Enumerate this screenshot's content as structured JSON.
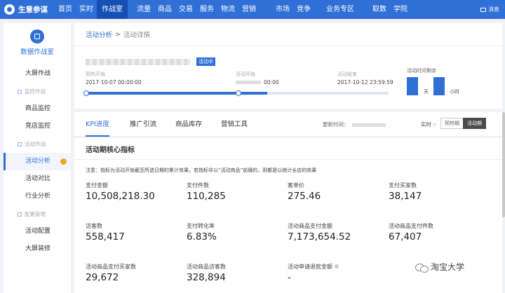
{
  "nav": {
    "brand": "生意参谋",
    "items": [
      "首页",
      "实时",
      "作战室",
      "流量",
      "商品",
      "交易",
      "服务",
      "物流",
      "营销",
      "市场",
      "竞争",
      "业务专区",
      "取数",
      "学院"
    ],
    "active_index": 2,
    "message": "消息"
  },
  "sidebar": {
    "title": "数据作战室",
    "items": [
      {
        "type": "item",
        "label": "大屏作战"
      },
      {
        "type": "section",
        "label": "监控作战"
      },
      {
        "type": "item",
        "label": "商品监控"
      },
      {
        "type": "item",
        "label": "竞店监控"
      },
      {
        "type": "section",
        "label": "活动作战"
      },
      {
        "type": "item",
        "label": "活动分析",
        "active": true
      },
      {
        "type": "item",
        "label": "活动对比"
      },
      {
        "type": "item",
        "label": "行业分析"
      },
      {
        "type": "section",
        "label": "配置管理"
      },
      {
        "type": "item",
        "label": "活动配置"
      },
      {
        "type": "item",
        "label": "大屏装修"
      }
    ]
  },
  "breadcrumb": {
    "link": "活动分析",
    "separator": ">",
    "current": "活动详情"
  },
  "activity": {
    "status_badge": "活动中",
    "preheat_label": "预热开始",
    "preheat_value": "2017-10-07 00:00:00",
    "start_label": "活动开始",
    "start_value": "00:00",
    "end_label": "活动结束",
    "end_value": "2017-10-12 23:59:59",
    "remaining_label": "活动时间剩余",
    "unit_day": "天",
    "unit_hour": "小时",
    "progress": 0.6
  },
  "tabs": [
    "KPI进度",
    "推广引流",
    "商品库存",
    "营销工具"
  ],
  "update": {
    "label": "更新时间：",
    "realtime": "实时",
    "seg_preheat": "预热期",
    "seg_active": "活动期"
  },
  "kpi": {
    "title": "活动期核心指标",
    "note": "注意：指标为活动开始截至所选日期的累计效果。若指标非以“活动商品”前缀的，则都是以统计全店的效果",
    "metrics": [
      {
        "label": "支付金额",
        "value": "10,508,218.30"
      },
      {
        "label": "支付件数",
        "value": "110,285"
      },
      {
        "label": "客单价",
        "value": "275.46"
      },
      {
        "label": "支付买家数",
        "value": "38,147"
      },
      {
        "label": "访客数",
        "value": "558,417"
      },
      {
        "label": "支付转化率",
        "value": "6.83%"
      },
      {
        "label": "活动商品支付金额",
        "value": "7,173,654.52"
      },
      {
        "label": "活动商品支付件数",
        "value": "67,407"
      },
      {
        "label": "活动商品支付买家数",
        "value": "29,672"
      },
      {
        "label": "活动商品访客数",
        "value": "328,894"
      },
      {
        "label": "活动申请退款金额",
        "value": "-"
      }
    ]
  },
  "watermark": "淘宝大学"
}
